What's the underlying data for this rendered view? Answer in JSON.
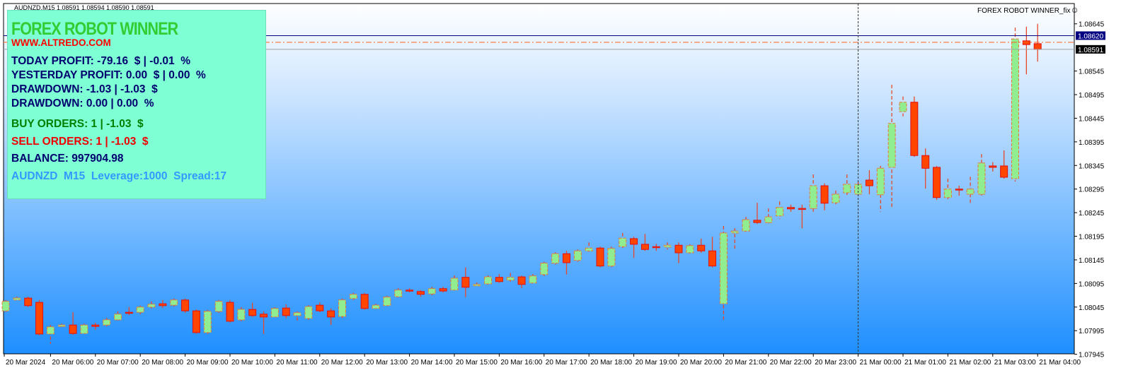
{
  "header": {
    "chart_title": "AUDNZD,M15  1.08591 1.08594 1.08590 1.08591",
    "indicator_label": "FOREX ROBOT WINNER_fix",
    "indicator_icon": "smiley-icon"
  },
  "panel": {
    "title": "FOREX ROBOT WINNER",
    "website": "WWW.ALTREDO.COM",
    "today_profit": "TODAY PROFIT: -79.16  $ | -0.01  %",
    "yesterday_profit": "YESTERDAY PROFIT: 0.00  $ | 0.00  %",
    "drawdown_money": "DRAWDOWN: -1.03 | -1.03  $",
    "drawdown_percent": "DRAWDOWN: 0.00 | 0.00  %",
    "buy_orders": "BUY ORDERS: 1 | -1.03  $",
    "sell_orders": "SELL ORDERS: 1 | -1.03  $",
    "balance": "BALANCE: 997904.98",
    "symbol_info": "AUDNZD  M15  Leverage:1000  Spread:17"
  },
  "colors": {
    "bull_fill": "#90ee90",
    "bear_fill": "#ff4500",
    "wick": "#e8482a",
    "ask_line": "#000080",
    "bid_line": "#a0a0a0",
    "order_line": "#ff6020",
    "panel_bg": "#7fffd4"
  },
  "chart_data": {
    "type": "candlestick",
    "symbol": "AUDNZD",
    "timeframe": "M15",
    "ylim": [
      1.07935,
      1.08688
    ],
    "y_ticks": [
      "1.08645",
      "1.08545",
      "1.08495",
      "1.08445",
      "1.08395",
      "1.08345",
      "1.08295",
      "1.08245",
      "1.08195",
      "1.08145",
      "1.08095",
      "1.08045",
      "1.07995",
      "1.07945"
    ],
    "ask_price": "1.08620",
    "bid_price": "1.08591",
    "order_price": 1.08606,
    "x_ticks": [
      "20 Mar 2024",
      "20 Mar 06:00",
      "20 Mar 07:00",
      "20 Mar 08:00",
      "20 Mar 09:00",
      "20 Mar 10:00",
      "20 Mar 11:00",
      "20 Mar 12:00",
      "20 Mar 13:00",
      "20 Mar 14:00",
      "20 Mar 15:00",
      "20 Mar 16:00",
      "20 Mar 17:00",
      "20 Mar 18:00",
      "20 Mar 19:00",
      "20 Mar 20:00",
      "20 Mar 21:00",
      "20 Mar 22:00",
      "20 Mar 23:00",
      "21 Mar 00:00",
      "21 Mar 01:00",
      "21 Mar 02:00",
      "21 Mar 03:00",
      "21 Mar 04:00"
    ],
    "first_bar": "20 Mar 05:00",
    "crosshair_bar": 76,
    "ohlc": [
      [
        1.08037,
        1.0806,
        1.08034,
        1.08057
      ],
      [
        1.0806,
        1.08067,
        1.08057,
        1.08064
      ],
      [
        1.08064,
        1.08067,
        1.08045,
        1.08048
      ],
      [
        1.08055,
        1.0806,
        1.07985,
        1.07988
      ],
      [
        1.07988,
        1.08007,
        1.07967,
        1.08003
      ],
      [
        1.08004,
        1.0801,
        1.08,
        1.08007
      ],
      [
        1.08007,
        1.08034,
        1.07986,
        1.07989
      ],
      [
        1.07989,
        1.0801,
        1.07986,
        1.08007
      ],
      [
        1.08007,
        1.08012,
        1.07997,
        1.08004
      ],
      [
        1.08007,
        1.08022,
        1.08004,
        1.08018
      ],
      [
        1.08018,
        1.08036,
        1.08015,
        1.0803
      ],
      [
        1.08034,
        1.08045,
        1.08028,
        1.08033
      ],
      [
        1.08034,
        1.08048,
        1.0803,
        1.08045
      ],
      [
        1.08045,
        1.08057,
        1.08042,
        1.08051
      ],
      [
        1.08052,
        1.0806,
        1.08043,
        1.08048
      ],
      [
        1.08049,
        1.08063,
        1.08046,
        1.0806
      ],
      [
        1.0806,
        1.08063,
        1.08033,
        1.08037
      ],
      [
        1.08037,
        1.0804,
        1.07988,
        1.07991
      ],
      [
        1.07991,
        1.08039,
        1.07988,
        1.08036
      ],
      [
        1.08036,
        1.0806,
        1.08033,
        1.08057
      ],
      [
        1.08055,
        1.0806,
        1.08012,
        1.08015
      ],
      [
        1.08018,
        1.08045,
        1.08015,
        1.0804
      ],
      [
        1.0804,
        1.08054,
        1.08024,
        1.08027
      ],
      [
        1.0803,
        1.08036,
        1.07988,
        1.08024
      ],
      [
        1.08024,
        1.08045,
        1.08021,
        1.08042
      ],
      [
        1.08043,
        1.08051,
        1.08021,
        1.08027
      ],
      [
        1.08027,
        1.08036,
        1.08015,
        1.08033
      ],
      [
        1.08021,
        1.08049,
        1.08018,
        1.08046
      ],
      [
        1.08049,
        1.08055,
        1.08034,
        1.08037
      ],
      [
        1.08037,
        1.08042,
        1.08007,
        1.08024
      ],
      [
        1.08025,
        1.08063,
        1.08022,
        1.0806
      ],
      [
        1.08063,
        1.08075,
        1.0806,
        1.08072
      ],
      [
        1.08072,
        1.08075,
        1.08039,
        1.08042
      ],
      [
        1.08042,
        1.08052,
        1.0804,
        1.08049
      ],
      [
        1.08048,
        1.08069,
        1.08045,
        1.08066
      ],
      [
        1.08067,
        1.08085,
        1.08064,
        1.08081
      ],
      [
        1.08081,
        1.08085,
        1.08076,
        1.08079
      ],
      [
        1.08078,
        1.08081,
        1.08067,
        1.08072
      ],
      [
        1.08073,
        1.08088,
        1.0807,
        1.08084
      ],
      [
        1.08084,
        1.08088,
        1.08076,
        1.08079
      ],
      [
        1.08081,
        1.08112,
        1.08078,
        1.08106
      ],
      [
        1.08108,
        1.08129,
        1.08066,
        1.08087
      ],
      [
        1.0809,
        1.08097,
        1.08087,
        1.08093
      ],
      [
        1.08094,
        1.08112,
        1.08091,
        1.08109
      ],
      [
        1.08108,
        1.08115,
        1.08096,
        1.08099
      ],
      [
        1.08102,
        1.08117,
        1.08099,
        1.08108
      ],
      [
        1.08109,
        1.08112,
        1.08085,
        1.08093
      ],
      [
        1.08096,
        1.08115,
        1.08093,
        1.08111
      ],
      [
        1.08114,
        1.08141,
        1.08111,
        1.08138
      ],
      [
        1.08138,
        1.08161,
        1.08135,
        1.08158
      ],
      [
        1.08158,
        1.08164,
        1.08114,
        1.08139
      ],
      [
        1.08144,
        1.08167,
        1.08141,
        1.08164
      ],
      [
        1.08164,
        1.08182,
        1.08161,
        1.0817
      ],
      [
        1.0817,
        1.08173,
        1.08129,
        1.08132
      ],
      [
        1.08132,
        1.08173,
        1.08129,
        1.08169
      ],
      [
        1.08173,
        1.08202,
        1.0817,
        1.08191
      ],
      [
        1.0819,
        1.08194,
        1.08149,
        1.08178
      ],
      [
        1.08178,
        1.082,
        1.08164,
        1.08167
      ],
      [
        1.08173,
        1.08179,
        1.08164,
        1.08172
      ],
      [
        1.08172,
        1.08182,
        1.08167,
        1.08176
      ],
      [
        1.08176,
        1.08182,
        1.08138,
        1.0816
      ],
      [
        1.0816,
        1.08178,
        1.08157,
        1.08175
      ],
      [
        1.08176,
        1.0819,
        1.0816,
        1.08164
      ],
      [
        1.08164,
        1.08194,
        1.08129,
        1.08132
      ],
      [
        1.08052,
        1.08217,
        1.08018,
        1.08202
      ],
      [
        1.08202,
        1.08212,
        1.08164,
        1.08206
      ],
      [
        1.08206,
        1.08236,
        1.08202,
        1.0823
      ],
      [
        1.08229,
        1.08266,
        1.08221,
        1.08224
      ],
      [
        1.08224,
        1.08254,
        1.08218,
        1.08236
      ],
      [
        1.08238,
        1.08269,
        1.08232,
        1.08256
      ],
      [
        1.08256,
        1.08262,
        1.08247,
        1.08253
      ],
      [
        1.08254,
        1.08262,
        1.08212,
        1.08253
      ],
      [
        1.08254,
        1.08326,
        1.08247,
        1.08302
      ],
      [
        1.08302,
        1.08307,
        1.0825,
        1.08265
      ],
      [
        1.08266,
        1.08292,
        1.08263,
        1.08284
      ],
      [
        1.08287,
        1.08326,
        1.08281,
        1.08305
      ],
      [
        1.08284,
        1.08311,
        1.08281,
        1.08305
      ],
      [
        1.08314,
        1.08335,
        1.08284,
        1.08302
      ],
      [
        1.08283,
        1.08344,
        1.08247,
        1.08339
      ],
      [
        1.08341,
        1.08516,
        1.08254,
        1.08434
      ],
      [
        1.08459,
        1.08491,
        1.08449,
        1.08479
      ],
      [
        1.08479,
        1.08491,
        1.08363,
        1.08366
      ],
      [
        1.08366,
        1.08381,
        1.08296,
        1.08339
      ],
      [
        1.08341,
        1.08344,
        1.08272,
        1.08277
      ],
      [
        1.08277,
        1.08317,
        1.08274,
        1.08295
      ],
      [
        1.08295,
        1.08302,
        1.08281,
        1.08293
      ],
      [
        1.08284,
        1.08321,
        1.08262,
        1.08295
      ],
      [
        1.08284,
        1.08369,
        1.08281,
        1.0835
      ],
      [
        1.08344,
        1.08352,
        1.08332,
        1.08341
      ],
      [
        1.08344,
        1.08377,
        1.08317,
        1.0832
      ],
      [
        1.08317,
        1.08637,
        1.08311,
        1.08613
      ],
      [
        1.08609,
        1.08639,
        1.08538,
        1.08601
      ],
      [
        1.08603,
        1.08645,
        1.08565,
        1.08591
      ]
    ]
  }
}
